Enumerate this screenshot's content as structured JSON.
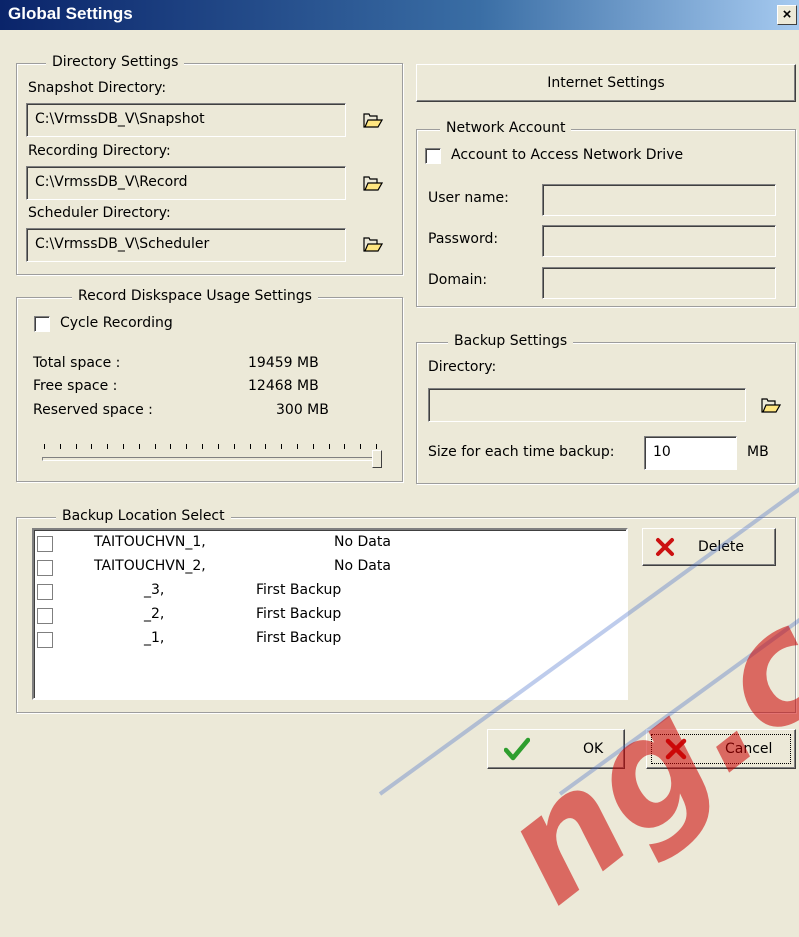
{
  "window": {
    "title": "Global Settings",
    "close_glyph": "×"
  },
  "directory_settings": {
    "legend": "Directory Settings",
    "snapshot_label": "Snapshot Directory:",
    "snapshot_value": "C:\\VrmssDB_V\\Snapshot",
    "recording_label": "Recording Directory:",
    "recording_value": "C:\\VrmssDB_V\\Record",
    "scheduler_label": "Scheduler Directory:",
    "scheduler_value": "C:\\VrmssDB_V\\Scheduler"
  },
  "diskspace": {
    "legend": "Record Diskspace Usage Settings",
    "cycle_label": "Cycle Recording",
    "cycle_checked": false,
    "total_label": "Total space :",
    "total_value": "19459 MB",
    "free_label": "Free space :",
    "free_value": "12468 MB",
    "reserved_label": "Reserved space :",
    "reserved_value": "300 MB",
    "slider_level": 1.0
  },
  "internet": {
    "button_label": "Internet Settings"
  },
  "network_account": {
    "legend": "Network Account",
    "access_label": "Account to Access Network Drive",
    "access_checked": false,
    "username_label": "User name:",
    "username_value": "",
    "password_label": "Password:",
    "password_value": "",
    "domain_label": "Domain:",
    "domain_value": ""
  },
  "backup_settings": {
    "legend": "Backup Settings",
    "directory_label": "Directory:",
    "directory_value": "",
    "size_label": "Size for each time backup:",
    "size_value": "10",
    "size_unit": "MB"
  },
  "backup_location": {
    "legend": "Backup Location Select",
    "rows": [
      {
        "name": "TAITOUCHVN_1,",
        "status": "No Data"
      },
      {
        "name": "TAITOUCHVN_2,",
        "status": "No Data"
      },
      {
        "name": "_3,",
        "status": "First Backup"
      },
      {
        "name": "_2,",
        "status": "First Backup"
      },
      {
        "name": "_1,",
        "status": "First Backup"
      }
    ],
    "delete_label": "Delete"
  },
  "footer": {
    "ok_label": "OK",
    "cancel_label": "Cancel"
  },
  "watermark": {
    "text": "ng.c"
  },
  "colors": {
    "title_bar": "#0a246a",
    "dialog_bg": "#ece9d8",
    "ok_check": "#2e9e2e",
    "cancel_x": "#cc1111"
  },
  "icons": {
    "folder": "folder-open-icon",
    "delete": "delete-x-icon",
    "ok": "checkmark-icon",
    "cancel": "cancel-x-icon"
  }
}
